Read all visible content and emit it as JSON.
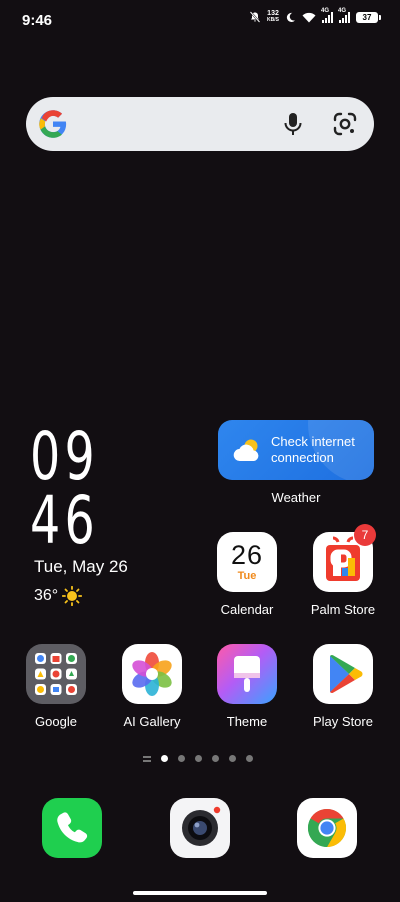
{
  "status_bar": {
    "time": "9:46",
    "net_speed_value": "132",
    "net_speed_unit": "KB/S",
    "sim1": "4G",
    "sim2": "4G",
    "battery": "37"
  },
  "search": {
    "logo": "google-g-icon",
    "mic": "microphone-icon",
    "lens": "google-lens-icon"
  },
  "clock": {
    "hour": "09",
    "minute": "46",
    "date": "Tue, May 26",
    "temperature": "36°"
  },
  "weather_widget": {
    "message": "Check internet connection",
    "label": "Weather"
  },
  "apps_row1": [
    {
      "label": "Calendar",
      "day": "26",
      "weekday": "Tue"
    },
    {
      "label": "Palm Store",
      "badge": "7"
    }
  ],
  "apps_row2": [
    {
      "label": "Google"
    },
    {
      "label": "AI Gallery"
    },
    {
      "label": "Theme"
    },
    {
      "label": "Play Store"
    }
  ],
  "dock": [
    {
      "name": "phone-icon"
    },
    {
      "name": "camera-icon"
    },
    {
      "name": "chrome-icon"
    }
  ],
  "colors": {
    "background": "#120e12",
    "weather_widget": "#2f86ee",
    "badge": "#ea3a3a"
  }
}
